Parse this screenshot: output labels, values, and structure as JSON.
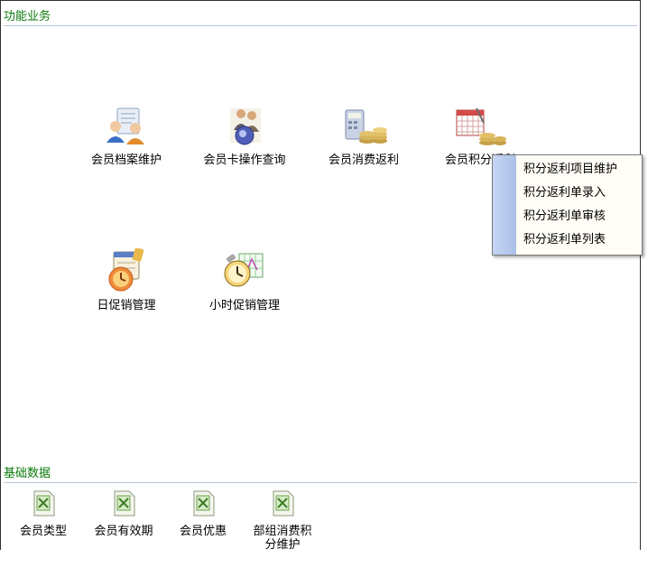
{
  "sections": {
    "business": {
      "title": "功能业务"
    },
    "basic": {
      "title": "基础数据"
    }
  },
  "business_items": [
    {
      "label": "会员档案维护",
      "icon": "member-profile-icon"
    },
    {
      "label": "会员卡操作查询",
      "icon": "member-card-query-icon"
    },
    {
      "label": "会员消费返利",
      "icon": "consumption-rebate-icon"
    },
    {
      "label": "会员积分返利",
      "icon": "points-rebate-icon"
    },
    {
      "label": "日促销管理",
      "icon": "daily-promotion-icon"
    },
    {
      "label": "小时促销管理",
      "icon": "hourly-promotion-icon"
    }
  ],
  "popup_menu": {
    "items": [
      "积分返利项目维护",
      "积分返利单录入",
      "积分返利单审核",
      "积分返利单列表"
    ]
  },
  "basic_items": [
    {
      "label": "会员类型",
      "icon": "spreadsheet-icon"
    },
    {
      "label": "会员有效期",
      "icon": "spreadsheet-icon"
    },
    {
      "label": "会员优惠",
      "icon": "spreadsheet-icon"
    },
    {
      "label": "部组消费积分维护",
      "icon": "spreadsheet-icon"
    }
  ],
  "colors": {
    "section_title": "#0c7a0c",
    "rule": "#b7c7dc",
    "popup_stripe": "#aac0ea"
  }
}
